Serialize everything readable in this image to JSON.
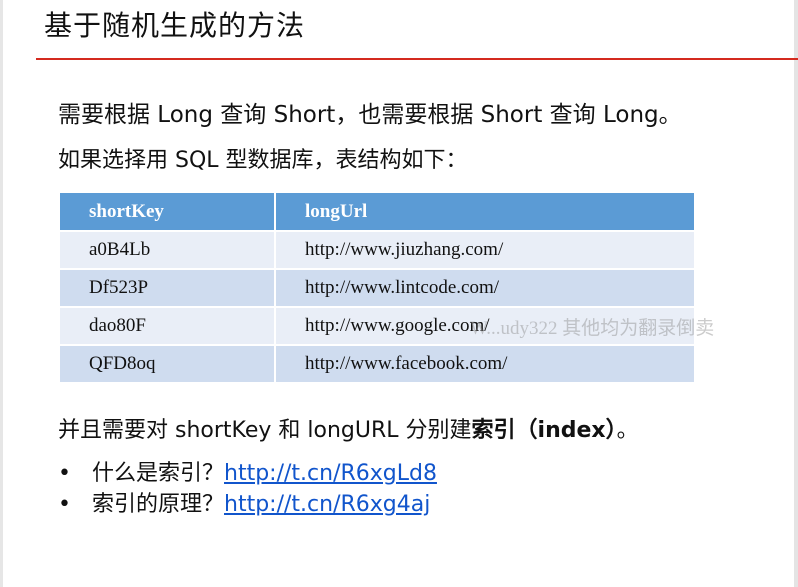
{
  "slide": {
    "title": "基于随机生成的方法",
    "line1": "需要根据 Long 查询 Short，也需要根据 Short 查询 Long。",
    "line2": "如果选择用 SQL 型数据库，表结构如下：",
    "line3_prefix": "并且需要对 shortKey 和 longURL 分别建",
    "line3_bold": "索引（index）",
    "line3_suffix": "。"
  },
  "table": {
    "headers": [
      "shortKey",
      "longUrl"
    ],
    "rows": [
      [
        "a0B4Lb",
        "http://www.jiuzhang.com/"
      ],
      [
        "Df523P",
        "http://www.lintcode.com/"
      ],
      [
        "dao80F",
        "http://www.google.com/"
      ],
      [
        "QFD8oq",
        "http://www.facebook.com/"
      ]
    ]
  },
  "watermark": "W...udy322 其他均为翻录倒卖",
  "bullets": [
    {
      "dot": "•",
      "text": "什么是索引？",
      "link": "http://t.cn/R6xgLd8"
    },
    {
      "dot": "•",
      "text": "索引的原理？",
      "link": "http://t.cn/R6xg4aj"
    }
  ]
}
